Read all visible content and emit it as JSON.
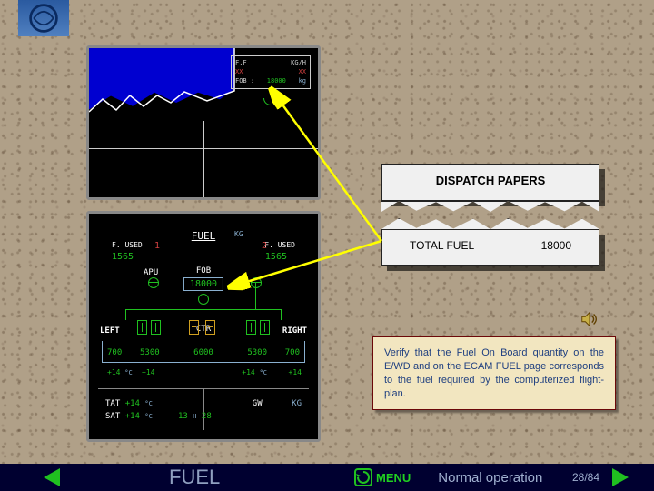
{
  "logo": {
    "name": "airline-logo"
  },
  "ewd": {
    "header_label": "F.F",
    "header_unit": "KG/H",
    "xx_l": "XX",
    "xx_r": "XX",
    "fob_label": "FOB :",
    "fob_value": "18000",
    "fob_unit": "kg"
  },
  "ecam": {
    "title": "FUEL",
    "unit": "KG",
    "fused_label": "F. USED",
    "eng1": "1",
    "eng2": "2",
    "fused_l": "1565",
    "fused_r": "1565",
    "apu": "APU",
    "fob_label": "FOB",
    "fob_value": "18000",
    "left_label": "LEFT",
    "ctr_label": "CTR",
    "right_label": "RIGHT",
    "tank_outer_l": "700",
    "tank_inner_l": "5300",
    "tank_ctr": "6000",
    "tank_inner_r": "5300",
    "tank_outer_r": "700",
    "temp_l1": "+14",
    "temp_l2": "+14",
    "temp_r1": "+14",
    "temp_r2": "+14",
    "temp_unit": "°C",
    "tat_label": "TAT",
    "tat_value": "+14",
    "sat_label": "SAT",
    "sat_value": "+14",
    "clock_h": "13",
    "clock_sep": "H",
    "clock_m": "28",
    "gw_label": "GW",
    "gw_unit": "KG"
  },
  "paper": {
    "title": "DISPATCH PAPERS",
    "total_fuel_label": "TOTAL FUEL",
    "total_fuel_value": "18000"
  },
  "note": "Verify that the Fuel On Board quantity on the E/WD and on the ECAM FUEL page corresponds to the fuel required by the computerized flight-plan.",
  "bar": {
    "title": "FUEL",
    "menu": "MENU",
    "mode": "Normal operation",
    "page": "28/84"
  }
}
